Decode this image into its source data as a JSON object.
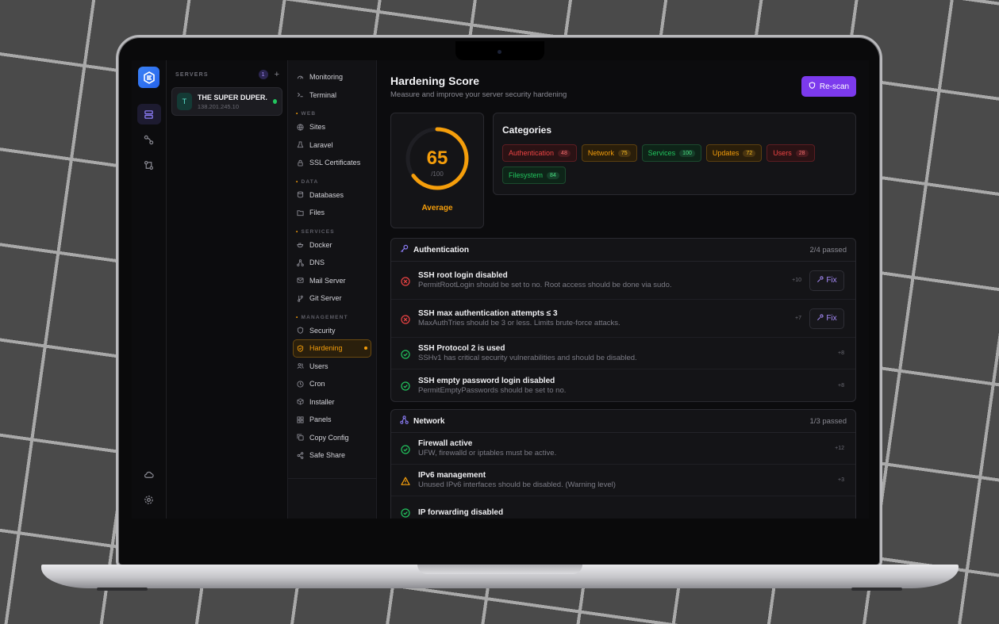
{
  "rail": {
    "logo_icon": "cube-logo-icon"
  },
  "servers": {
    "caption": "SERVERS",
    "count": "1",
    "add_label": "+",
    "list": [
      {
        "initial": "T",
        "name": "THE SUPER DUPER...",
        "ip": "138.201.245.10",
        "status": "online"
      }
    ]
  },
  "nav": {
    "top": [
      {
        "label": "Monitoring",
        "icon": "gauge-icon"
      },
      {
        "label": "Terminal",
        "icon": "terminal-icon"
      }
    ],
    "sections": [
      {
        "caption": "WEB",
        "items": [
          {
            "label": "Sites",
            "icon": "globe-icon"
          },
          {
            "label": "Laravel",
            "icon": "flask-icon"
          },
          {
            "label": "SSL Certificates",
            "icon": "lock-icon"
          }
        ]
      },
      {
        "caption": "DATA",
        "items": [
          {
            "label": "Databases",
            "icon": "database-icon"
          },
          {
            "label": "Files",
            "icon": "folder-icon"
          }
        ]
      },
      {
        "caption": "SERVICES",
        "items": [
          {
            "label": "Docker",
            "icon": "docker-icon"
          },
          {
            "label": "DNS",
            "icon": "dns-icon"
          },
          {
            "label": "Mail Server",
            "icon": "mail-icon"
          },
          {
            "label": "Git Server",
            "icon": "git-icon"
          }
        ]
      },
      {
        "caption": "MANAGEMENT",
        "items": [
          {
            "label": "Security",
            "icon": "shield-icon"
          },
          {
            "label": "Hardening",
            "icon": "shield-check-icon",
            "active": true
          },
          {
            "label": "Users",
            "icon": "users-icon"
          },
          {
            "label": "Cron",
            "icon": "clock-icon"
          },
          {
            "label": "Installer",
            "icon": "package-icon"
          },
          {
            "label": "Panels",
            "icon": "grid-icon"
          },
          {
            "label": "Copy Config",
            "icon": "copy-icon"
          },
          {
            "label": "Safe Share",
            "icon": "share-icon"
          }
        ]
      }
    ]
  },
  "header": {
    "title": "Hardening Score",
    "subtitle": "Measure and improve your server security hardening",
    "rescan_label": "Re-scan"
  },
  "score": {
    "value": "65",
    "max": "/100",
    "fraction": 0.65,
    "label": "Average",
    "color": "#f59e0b"
  },
  "categories": {
    "title": "Categories",
    "items": [
      {
        "name": "Authentication",
        "score": "48",
        "tone": "red"
      },
      {
        "name": "Network",
        "score": "75",
        "tone": "amber"
      },
      {
        "name": "Services",
        "score": "100",
        "tone": "green"
      },
      {
        "name": "Updates",
        "score": "72",
        "tone": "amber"
      },
      {
        "name": "Users",
        "score": "28",
        "tone": "red"
      },
      {
        "name": "Filesystem",
        "score": "84",
        "tone": "green"
      }
    ]
  },
  "sections": [
    {
      "title": "Authentication",
      "icon": "key-icon",
      "passed": "2/4 passed",
      "checks": [
        {
          "status": "fail",
          "title": "SSH root login disabled",
          "desc": "PermitRootLogin should be set to no. Root access should be done via sudo.",
          "points": "+10",
          "fix_label": "Fix"
        },
        {
          "status": "fail",
          "title": "SSH max authentication attempts ≤ 3",
          "desc": "MaxAuthTries should be 3 or less. Limits brute-force attacks.",
          "points": "+7",
          "fix_label": "Fix"
        },
        {
          "status": "pass",
          "title": "SSH Protocol 2 is used",
          "desc": "SSHv1 has critical security vulnerabilities and should be disabled.",
          "points": "+8"
        },
        {
          "status": "pass",
          "title": "SSH empty password login disabled",
          "desc": "PermitEmptyPasswords should be set to no.",
          "points": "+8"
        }
      ]
    },
    {
      "title": "Network",
      "icon": "network-icon",
      "passed": "1/3 passed",
      "checks": [
        {
          "status": "pass",
          "title": "Firewall active",
          "desc": "UFW, firewalld or iptables must be active.",
          "points": "+12"
        },
        {
          "status": "warn",
          "title": "IPv6 management",
          "desc": "Unused IPv6 interfaces should be disabled. (Warning level)",
          "points": "+3"
        },
        {
          "status": "pass",
          "title": "IP forwarding disabled",
          "desc": "",
          "points": ""
        }
      ]
    }
  ],
  "colors": {
    "accent": "#7c3aed",
    "warning": "#f59e0b",
    "pass": "#22c55e",
    "fail": "#ef4444"
  }
}
